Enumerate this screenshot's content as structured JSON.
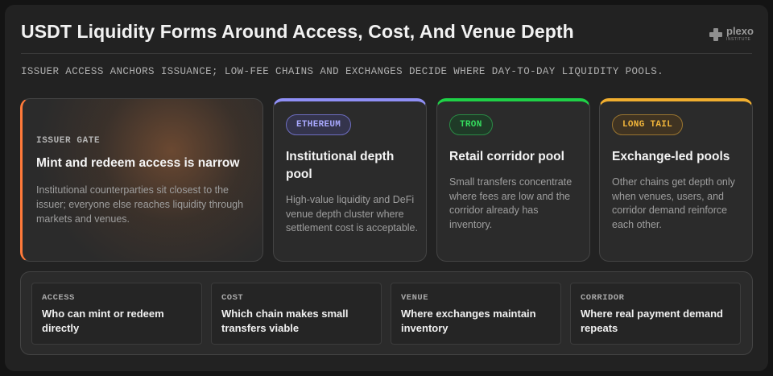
{
  "title": "USDT Liquidity Forms Around Access, Cost, And Venue Depth",
  "logo": {
    "word": "plexo",
    "sub": "INSTITUTE"
  },
  "subtitle": "ISSUER ACCESS ANCHORS ISSUANCE; LOW-FEE CHAINS AND EXCHANGES DECIDE WHERE DAY-TO-DAY LIQUIDITY POOLS.",
  "cards": [
    {
      "eyebrow": "ISSUER GATE",
      "title": "Mint and redeem access is narrow",
      "body": "Institutional counterparties sit closest to the issuer; everyone else reaches liquidity through markets and venues.",
      "accent": "#ff7a3a"
    },
    {
      "pill": "ETHEREUM",
      "title": "Institutional depth pool",
      "body": "High-value liquidity and DeFi venue depth cluster where settlement cost is acceptable.",
      "accent": "#8f8ff5"
    },
    {
      "pill": "TRON",
      "title": "Retail corridor pool",
      "body": "Small transfers concentrate where fees are low and the corridor already has inventory.",
      "accent": "#1fd147"
    },
    {
      "pill": "LONG TAIL",
      "title": "Exchange-led pools",
      "body": "Other chains get depth only when venues, users, and corridor demand reinforce each other.",
      "accent": "#f0ae2f"
    }
  ],
  "factors": [
    {
      "label": "ACCESS",
      "text": "Who can mint or redeem directly"
    },
    {
      "label": "COST",
      "text": "Which chain makes small transfers viable"
    },
    {
      "label": "VENUE",
      "text": "Where exchanges maintain inventory"
    },
    {
      "label": "CORRIDOR",
      "text": "Where real payment demand repeats"
    }
  ]
}
